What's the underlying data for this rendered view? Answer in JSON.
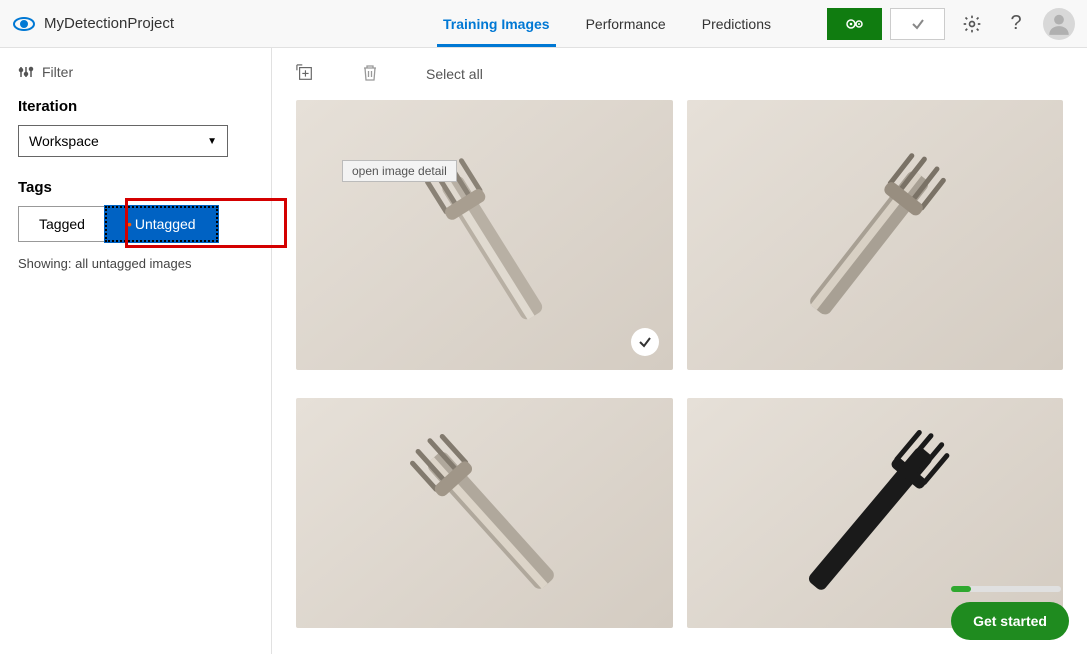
{
  "header": {
    "project_name": "MyDetectionProject",
    "tabs": [
      {
        "label": "Training Images",
        "active": true
      },
      {
        "label": "Performance",
        "active": false
      },
      {
        "label": "Predictions",
        "active": false
      }
    ]
  },
  "sidebar": {
    "filter_label": "Filter",
    "iteration_heading": "Iteration",
    "iteration_value": "Workspace",
    "tags_heading": "Tags",
    "seg": {
      "tagged": "Tagged",
      "untagged": "Untagged"
    },
    "showing_text": "Showing: all untagged images"
  },
  "toolbar": {
    "select_all": "Select all"
  },
  "gallery": {
    "tooltip": "open image detail"
  },
  "cta": {
    "get_started": "Get started"
  }
}
